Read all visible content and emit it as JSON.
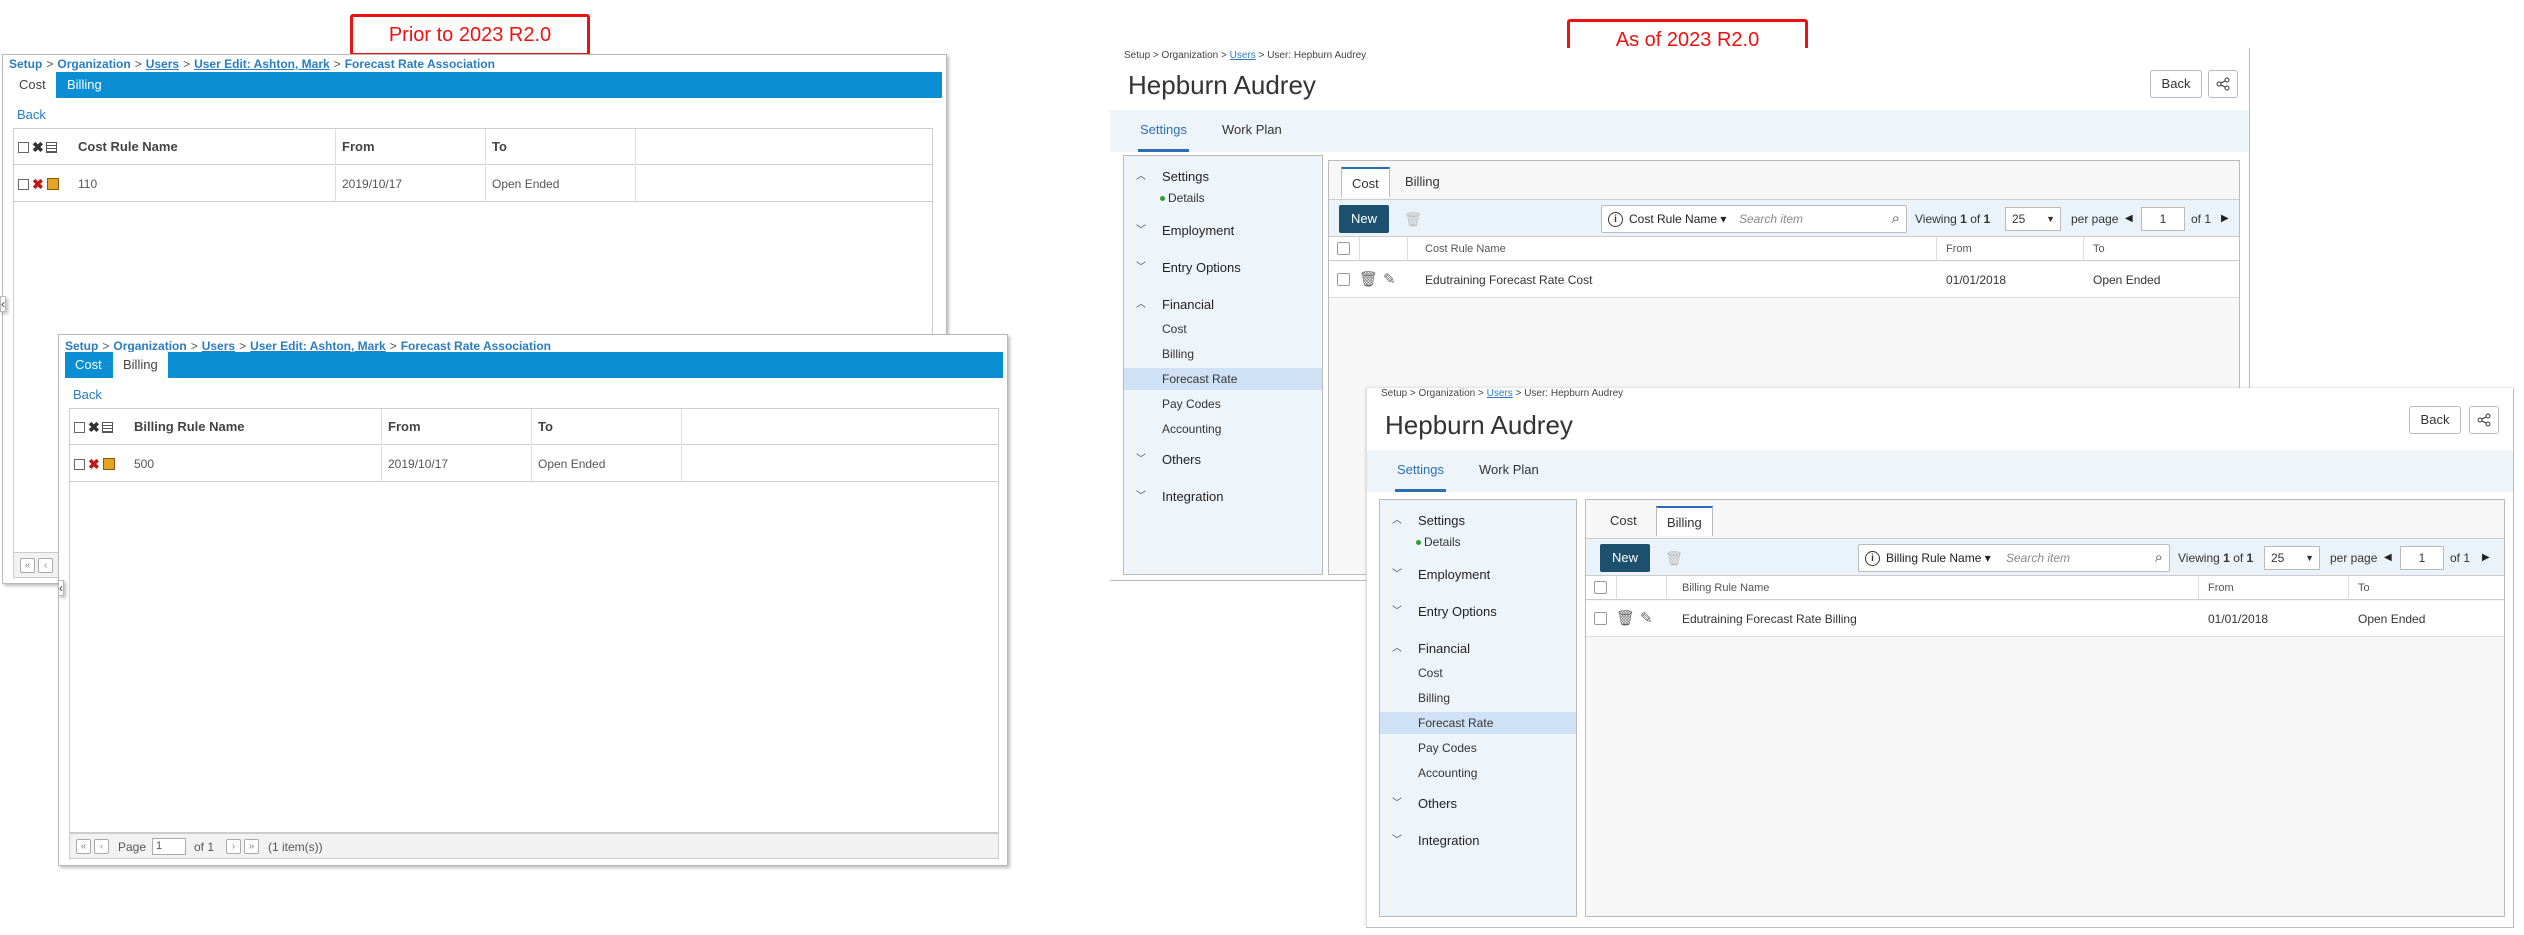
{
  "labels": {
    "prior": "Prior to 2023 R2.0",
    "asof": "As of 2023 R2.0"
  },
  "legacy": {
    "crumb_sep": ">",
    "cost_panel": {
      "crumbs": [
        "Setup",
        "Organization",
        "Users",
        "User Edit: Ashton, Mark",
        "Forecast Rate Association"
      ],
      "tabs": [
        "Cost",
        "Billing"
      ],
      "back": "Back",
      "columns": [
        "Cost Rule Name",
        "From",
        "To"
      ],
      "row": {
        "name": "110",
        "from": "2019/10/17",
        "to": "Open Ended"
      }
    },
    "billing_panel": {
      "crumbs": [
        "Setup",
        "Organization",
        "Users",
        "User Edit: Ashton, Mark",
        "Forecast Rate Association"
      ],
      "tabs": [
        "Cost",
        "Billing"
      ],
      "back": "Back",
      "columns": [
        "Billing Rule Name",
        "From",
        "To"
      ],
      "row": {
        "name": "500",
        "from": "2019/10/17",
        "to": "Open Ended"
      },
      "pager": {
        "page_label": "Page",
        "page_value": "1",
        "of": "of 1",
        "items": "(1 item(s))"
      }
    }
  },
  "new": {
    "crumb_sep": ">",
    "crumbs": [
      "Setup",
      "Organization",
      "Users",
      "User: Hepburn Audrey"
    ],
    "title": "Hepburn Audrey",
    "back": "Back",
    "nav_tabs": [
      "Settings",
      "Work Plan"
    ],
    "sidebar": {
      "settings": "Settings",
      "details": "Details",
      "employment": "Employment",
      "entry_options": "Entry Options",
      "financial": "Financial",
      "fin_items": [
        "Cost",
        "Billing",
        "Forecast Rate",
        "Pay Codes",
        "Accounting"
      ],
      "others": "Others",
      "integration": "Integration"
    },
    "subtabs": [
      "Cost",
      "Billing"
    ],
    "new_btn": "New",
    "search_placeholder": "Search item",
    "viewing": "Viewing",
    "view_from": "1",
    "view_of": "of",
    "view_to": "1",
    "page_size": "25",
    "per_page": "per page",
    "page_num": "1",
    "page_of": "of 1",
    "cost": {
      "search_field": "Cost Rule Name",
      "columns": [
        "Cost Rule Name",
        "From",
        "To"
      ],
      "row": {
        "name": "Edutraining Forecast Rate Cost",
        "from": "01/01/2018",
        "to": "Open Ended"
      }
    },
    "billing": {
      "search_field": "Billing Rule Name",
      "columns": [
        "Billing Rule Name",
        "From",
        "To"
      ],
      "row": {
        "name": "Edutraining Forecast Rate Billing",
        "from": "01/01/2018",
        "to": "Open Ended"
      }
    }
  }
}
